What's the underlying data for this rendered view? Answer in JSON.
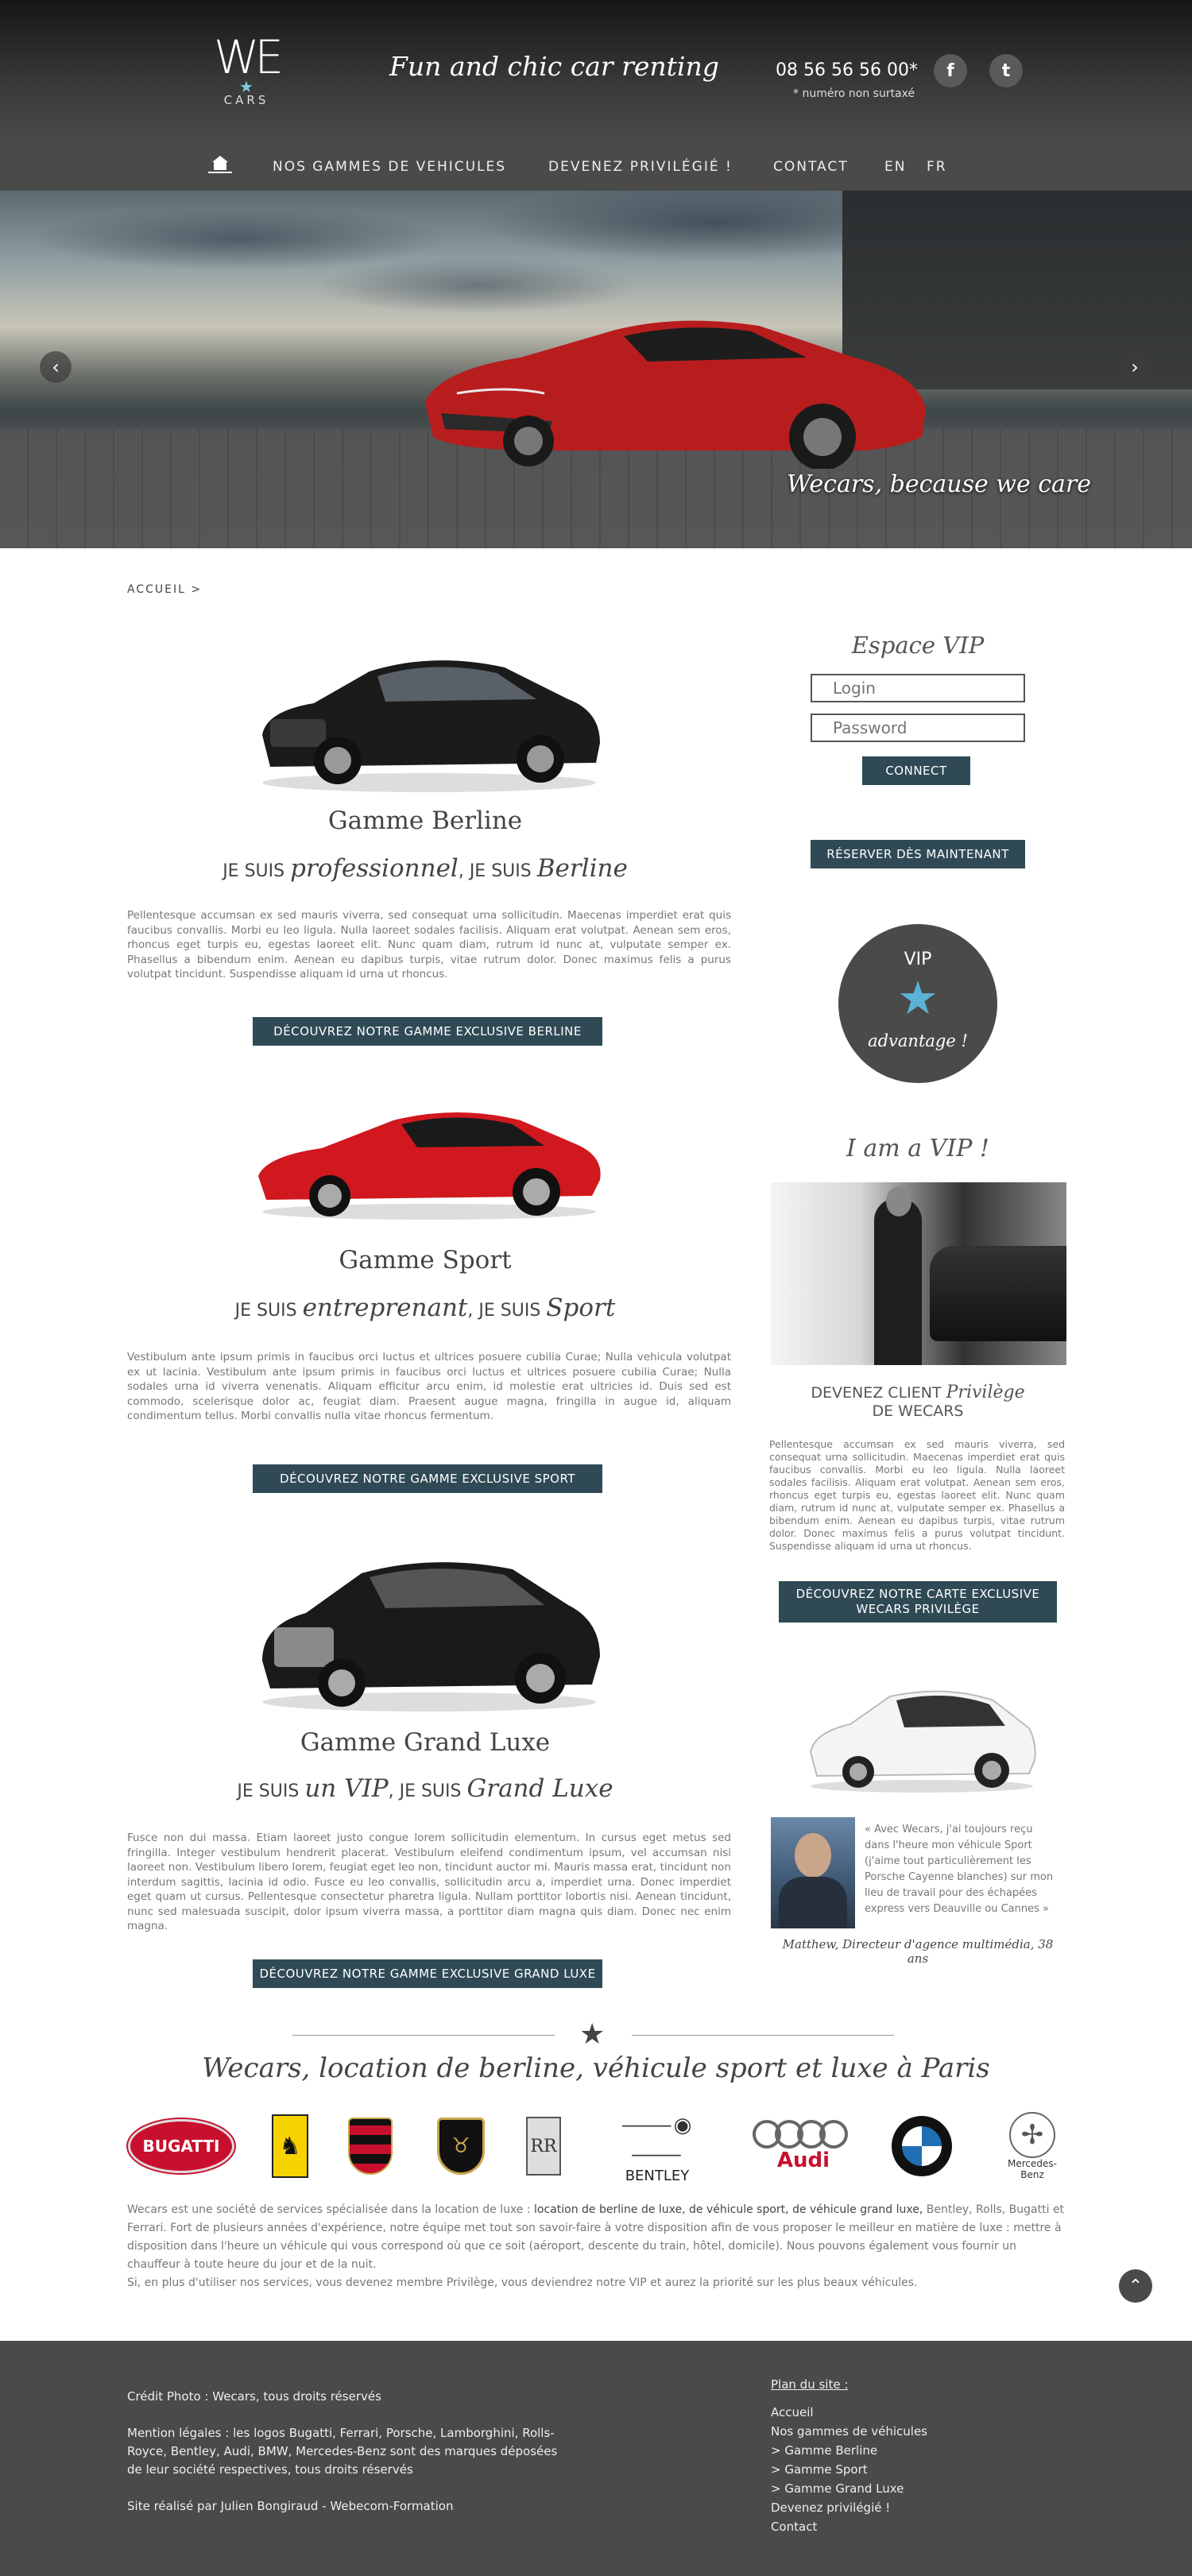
{
  "header": {
    "logo_word": "WE",
    "logo_sub": "CARS",
    "tagline": "Fun and chic car renting",
    "phone": "08 56 56 56 00*",
    "phone_note": "* numéro non surtaxé",
    "social": [
      "f",
      "t"
    ]
  },
  "nav": {
    "items": [
      "NOS GAMMES DE VEHICULES",
      "DEVENEZ PRIVILÉGIÉ !",
      "CONTACT",
      "EN",
      "FR"
    ]
  },
  "hero": {
    "caption": "Wecars, because we care",
    "prev": "‹",
    "next": "›"
  },
  "breadcrumb": "ACCUEIL >",
  "ranges": [
    {
      "title": "Gamme Berline",
      "sub_prefix": "JE SUIS ",
      "sub_word1": "professionnel",
      "sub_mid": ", JE SUIS ",
      "sub_word2": "Berline",
      "text": "Pellentesque accumsan ex sed mauris viverra, sed consequat urna sollicitudin. Maecenas imperdiet erat quis faucibus convallis. Morbi eu leo ligula. Nulla laoreet sodales facilisis. Aliquam erat volutpat. Aenean sem eros, rhoncus eget turpis eu, egestas laoreet elit. Nunc quam diam, rutrum id nunc at, vulputate semper ex. Phasellus a bibendum enim. Aenean eu dapibus turpis, vitae rutrum dolor. Donec maximus felis a purus volutpat tincidunt. Suspendisse aliquam id urna ut rhoncus.",
      "button": "DÉCOUVREZ NOTRE GAMME EXCLUSIVE BERLINE"
    },
    {
      "title": "Gamme Sport",
      "sub_prefix": "JE SUIS ",
      "sub_word1": "entreprenant",
      "sub_mid": ", JE SUIS ",
      "sub_word2": "Sport",
      "text": "Vestibulum ante ipsum primis in faucibus orci luctus et ultrices posuere cubilia Curae; Nulla vehicula volutpat ex ut lacinia. Vestibulum ante ipsum primis in faucibus orci luctus et ultrices posuere cubilia Curae; Nulla sodales urna id viverra venenatis. Aliquam efficitur arcu enim, id molestie erat ultricies id. Duis sed est commodo, scelerisque dolor ac, feugiat diam. Praesent augue magna, fringilla in augue id, aliquam condimentum tellus. Morbi convallis nulla vitae rhoncus fermentum.",
      "button": "DÉCOUVREZ NOTRE GAMME EXCLUSIVE SPORT"
    },
    {
      "title": "Gamme Grand Luxe",
      "sub_prefix": "JE SUIS ",
      "sub_word1": "un VIP",
      "sub_mid": ", JE SUIS ",
      "sub_word2": "Grand Luxe",
      "text": "Fusce non dui massa. Etiam laoreet justo congue lorem sollicitudin elementum. In cursus eget metus sed fringilla. Integer vestibulum hendrerit placerat. Vestibulum eleifend condimentum ipsum, vel accumsan nisi laoreet non. Vestibulum libero lorem, feugiat eget leo non, tincidunt auctor mi. Mauris massa erat, tincidunt non interdum sagittis, lacinia id odio. Fusce eu leo convallis, sollicitudin arcu a, imperdiet urna. Donec imperdiet eget quam ut cursus. Pellentesque consectetur pharetra ligula. Nullam porttitor lobortis nisi. Aenean tincidunt, nunc sed malesuada suscipit, dolor ipsum viverra massa, a porttitor diam magna quis diam. Donec nec enim magna.",
      "button": "DÉCOUVREZ NOTRE GAMME EXCLUSIVE GRAND LUXE"
    }
  ],
  "vip": {
    "title": "Espace VIP",
    "login_placeholder": "Login",
    "password_placeholder": "Password",
    "connect": "CONNECT",
    "reserve": "RÉSERVER DÈS MAINTENANT",
    "badge_top": "VIP",
    "badge_bottom": "advantage !",
    "iam": "I am a VIP !",
    "client_line1_a": "DEVENEZ CLIENT ",
    "client_line1_b": "Privilège",
    "client_line2": "DE WECARS",
    "client_text": "Pellentesque accumsan ex sed mauris viverra, sed consequat urna sollicitudin. Maecenas imperdiet erat quis faucibus convallis. Morbi eu leo ligula. Nulla laoreet sodales facilisis. Aliquam erat volutpat. Aenean sem eros, rhoncus eget turpis eu, egestas laoreet elit. Nunc quam diam, rutrum id nunc at, vulputate semper ex. Phasellus a bibendum enim. Aenean eu dapibus turpis, vitae rutrum dolor. Donec maximus felis a purus volutpat tincidunt. Suspendisse aliquam id urna ut rhoncus.",
    "card_button": "DÉCOUVREZ NOTRE CARTE EXCLUSIVE WECARS PRIVILÈGE",
    "testimonial": "« Avec Wecars, j'ai toujours reçu dans l'heure mon véhicule Sport (j'aime tout particulièrement les Porsche Cayenne blanches) sur mon lieu de travail pour des échapées express vers Deauville ou Cannes »",
    "testimonial_author": "Matthew, Directeur d'agence multimédia, 38 ans"
  },
  "seo": {
    "title": "Wecars, location de berline, véhicule sport et luxe à Paris",
    "brands": [
      "BUGATTI",
      "Ferrari",
      "Porsche",
      "Lamborghini",
      "Rolls-Royce",
      "BENTLEY",
      "Audi",
      "BMW",
      "Mercedes-Benz"
    ],
    "text_a": "Wecars est une société de services spécialisée dans la location de luxe : ",
    "text_b": "location de berline de luxe, de véhicule sport, de véhicule grand luxe,",
    "text_c": " Bentley, Rolls, Bugatti et Ferrari. Fort de plusieurs années d'expérience, notre équipe met tout son savoir-faire à votre disposition afin de vous proposer le meilleur en matière de luxe : mettre à disposition dans l'heure un véhicule qui vous correspond où que ce soit (aéroport, descente du train, hôtel, domicile). Nous pouvons également vous fournir un chauffeur à toute heure du jour et de la nuit.",
    "text_d": "Si, en plus d'utiliser nos services, vous devenez membre Privilège, vous deviendrez notre VIP et aurez la priorité sur les plus beaux véhicules."
  },
  "footer": {
    "credit": "Crédit Photo : Wecars, tous droits réservés",
    "legal": "Mention légales : les logos Bugatti, Ferrari, Porsche, Lamborghini, Rolls-Royce, Bentley, Audi, BMW, Mercedes-Benz sont des marques déposées de leur société respectives, tous droits réservés",
    "made_by": "Site réalisé par Julien Bongiraud - Webecom-Formation",
    "sitemap_title": "Plan du site :",
    "sitemap": [
      "Accueil",
      "Nos gammes de véhicules",
      "> Gamme Berline",
      "> Gamme Sport",
      "> Gamme Grand Luxe",
      "Devenez privilégié !",
      "Contact"
    ]
  }
}
